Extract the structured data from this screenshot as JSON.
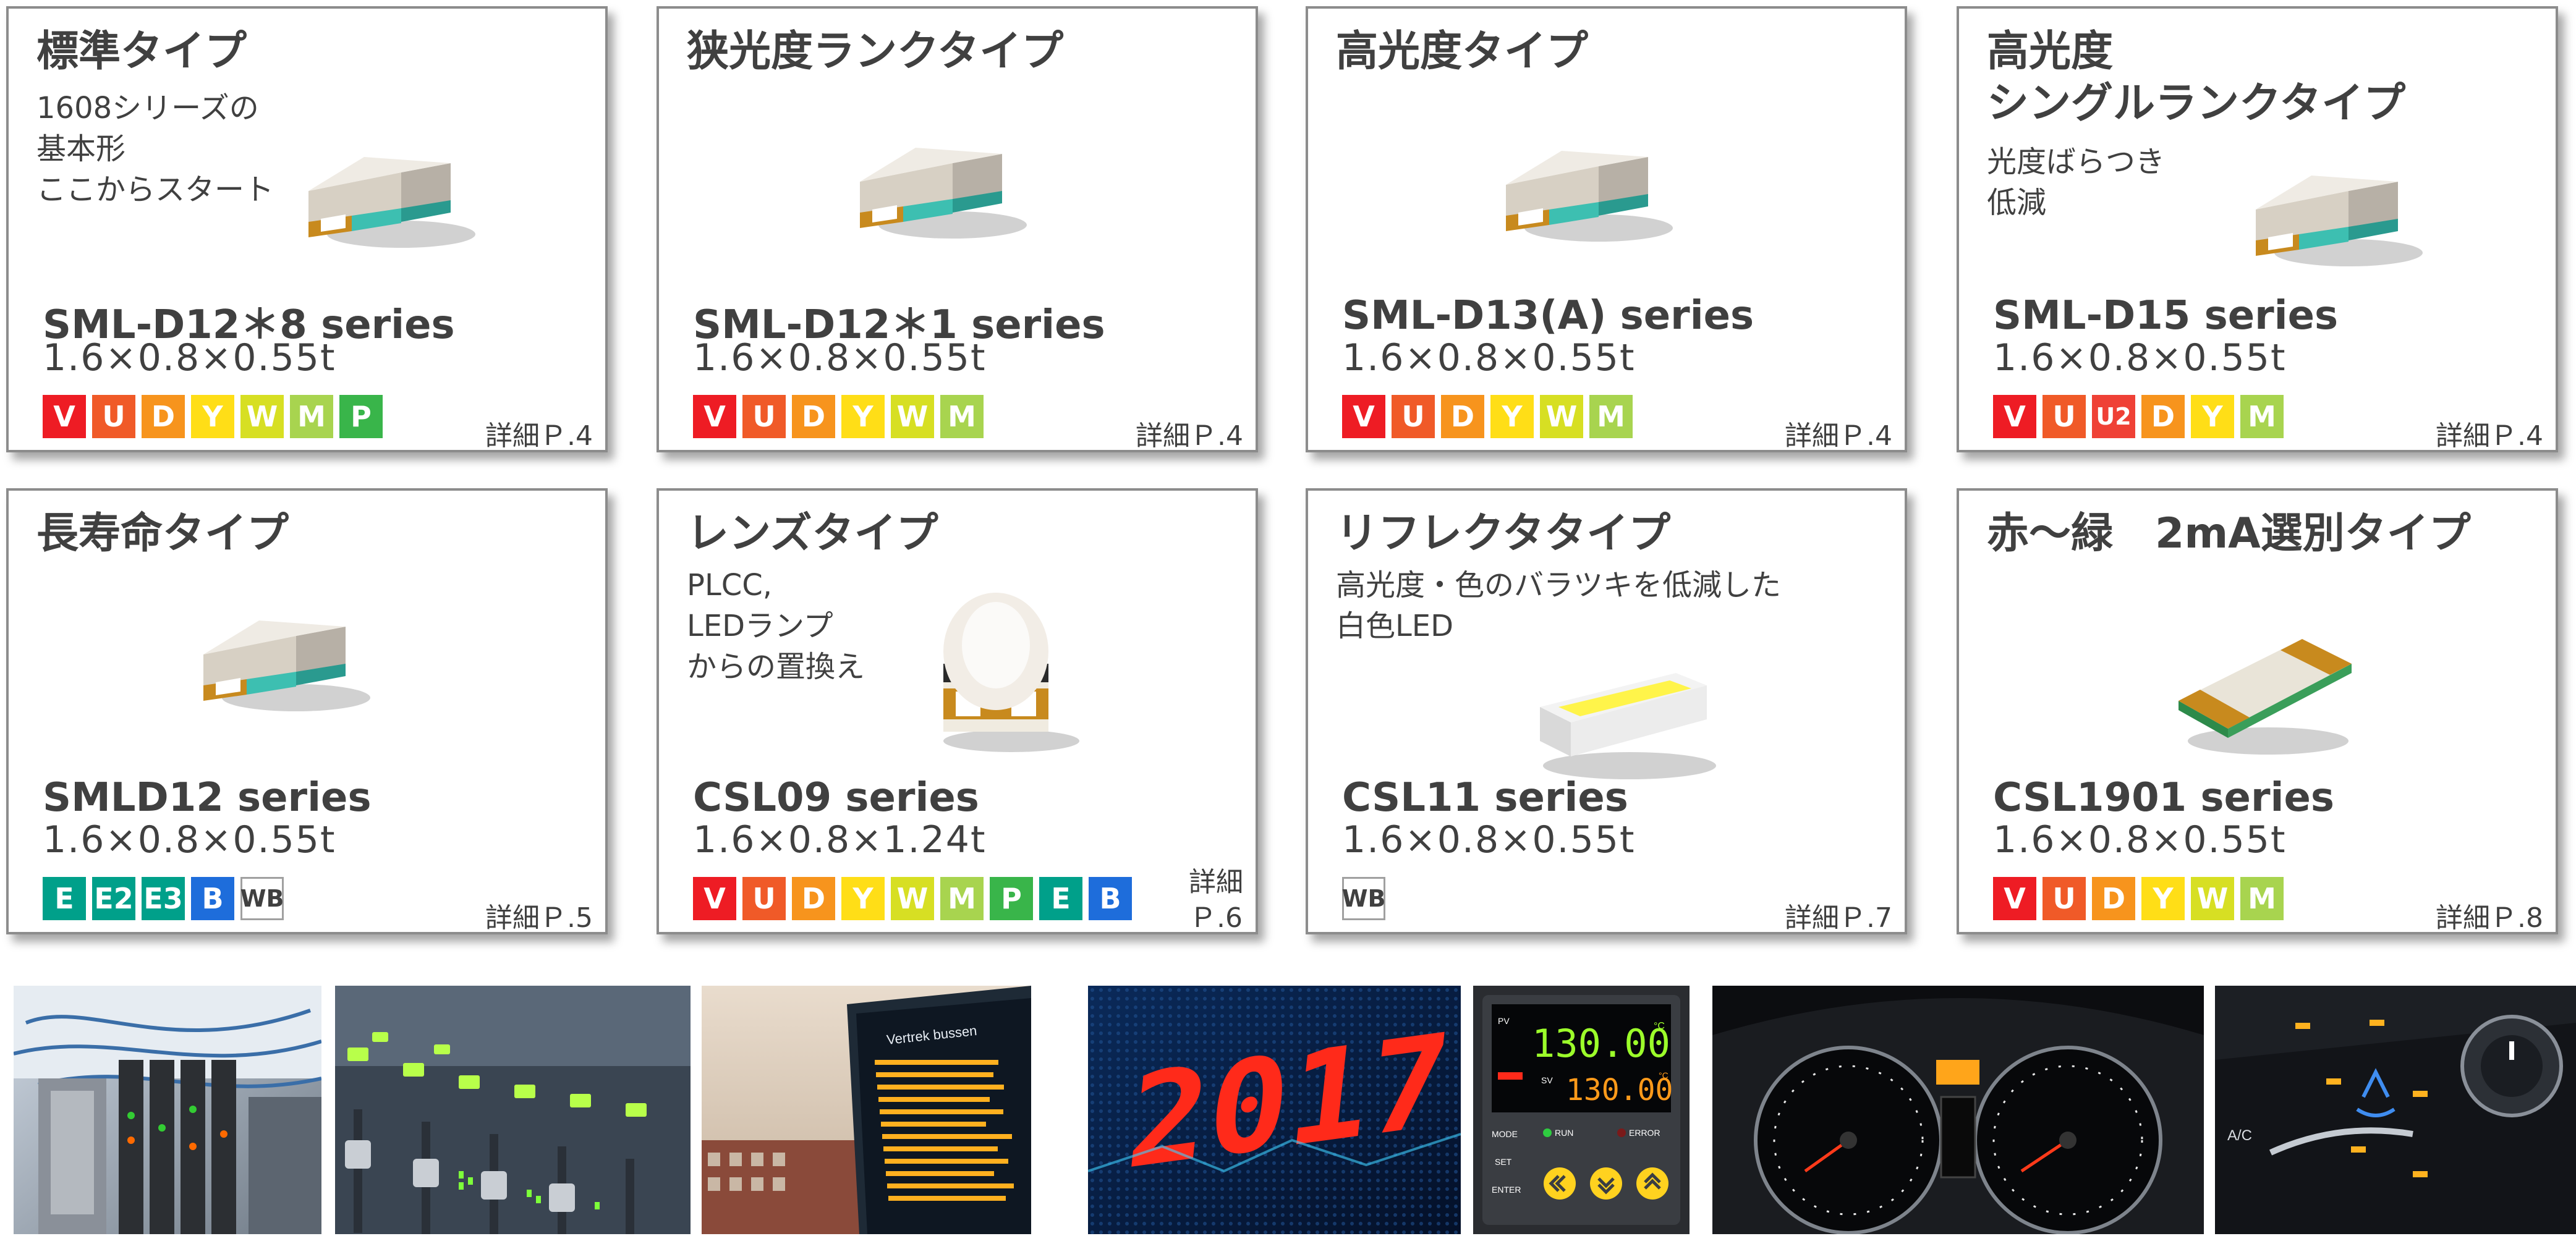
{
  "colors": {
    "V": "#ee1c24",
    "U": "#f05a28",
    "U2": "#ef4136",
    "D": "#f7941d",
    "Y": "#ffde17",
    "W": "#d7df23",
    "M": "#a8d44f",
    "P": "#39b54a",
    "E": "#00a08a",
    "E2": "#00a08a",
    "E3": "#00a08a",
    "B": "#1e6ddb",
    "WB": "#ffffff"
  },
  "cards": [
    {
      "title": "標準タイプ",
      "desc": [
        "1608シリーズの",
        "基本形",
        "ここからスタート"
      ],
      "series": "SML-D12＊8 series",
      "dims": "1.6×0.8×0.55t",
      "badges": [
        "V",
        "U",
        "D",
        "Y",
        "W",
        "M",
        "P"
      ],
      "detail": "詳細Ｐ.4",
      "image": "chip-led-icon"
    },
    {
      "title": "狭光度ランクタイプ",
      "desc": [],
      "series": "SML-D12＊1 series",
      "dims": "1.6×0.8×0.55t",
      "badges": [
        "V",
        "U",
        "D",
        "Y",
        "W",
        "M"
      ],
      "detail": "詳細Ｐ.4",
      "image": "chip-led-icon"
    },
    {
      "title": "高光度タイプ",
      "desc": [],
      "series": "SML-D13(A) series",
      "dims": "1.6×0.8×0.55t",
      "badges": [
        "V",
        "U",
        "D",
        "Y",
        "W",
        "M"
      ],
      "detail": "詳細Ｐ.4",
      "image": "chip-led-icon"
    },
    {
      "title": "高光度 シングルランクタイプ",
      "title_lines": [
        "高光度",
        "シングルランクタイプ"
      ],
      "desc": [
        "光度ばらつき",
        "低減"
      ],
      "series": "SML-D15 series",
      "dims": "1.6×0.8×0.55t",
      "badges": [
        "V",
        "U",
        "U2",
        "D",
        "Y",
        "M"
      ],
      "detail": "詳細Ｐ.4",
      "image": "chip-led-icon"
    },
    {
      "title": "長寿命タイプ",
      "desc": [],
      "series": "SMLD12 series",
      "dims": "1.6×0.8×0.55t",
      "badges": [
        "E",
        "E2",
        "E3",
        "B",
        "WB"
      ],
      "detail": "詳細Ｐ.5",
      "image": "chip-led-icon"
    },
    {
      "title": "レンズタイプ",
      "desc": [
        "PLCC,",
        "LEDランプ",
        "からの置換え"
      ],
      "series": "CSL09 series",
      "dims": "1.6×0.8×1.24t",
      "badges": [
        "V",
        "U",
        "D",
        "Y",
        "W",
        "M",
        "P",
        "E",
        "B"
      ],
      "detail_lines": [
        "詳細",
        "Ｐ.6"
      ],
      "image": "lens-led-icon"
    },
    {
      "title": "リフレクタタイプ",
      "desc": [
        "高光度・色のバラツキを低減した",
        "白色LED"
      ],
      "series": "CSL11 series",
      "dims": "1.6×0.8×0.55t",
      "badges": [
        "WB"
      ],
      "detail": "詳細Ｐ.7",
      "image": "reflector-led-icon"
    },
    {
      "title": "赤～緑　2mA選別タイプ",
      "desc": [],
      "series": "CSL1901 series",
      "dims": "1.6×0.8×0.55t",
      "badges": [
        "V",
        "U",
        "D",
        "Y",
        "W",
        "M"
      ],
      "detail": "詳細Ｐ.8",
      "image": "flat-led-icon"
    }
  ],
  "photos": [
    {
      "name": "industrial-equipment-photo"
    },
    {
      "name": "audio-mixer-photo"
    },
    {
      "name": "departure-board-photo",
      "board_title": "Vertrek bussen"
    },
    {
      "name": "led-matrix-display-photo",
      "display_text": "2017"
    },
    {
      "name": "temperature-controller-photo",
      "pv": "130.00",
      "sv": "130.00",
      "labels": [
        "PV",
        "SV",
        "MODE",
        "SET",
        "ENTER",
        "RUN",
        "ERROR",
        "°C",
        "°C"
      ]
    },
    {
      "name": "car-dashboard-photo"
    },
    {
      "name": "car-climate-control-photo",
      "label": "A/C"
    }
  ]
}
